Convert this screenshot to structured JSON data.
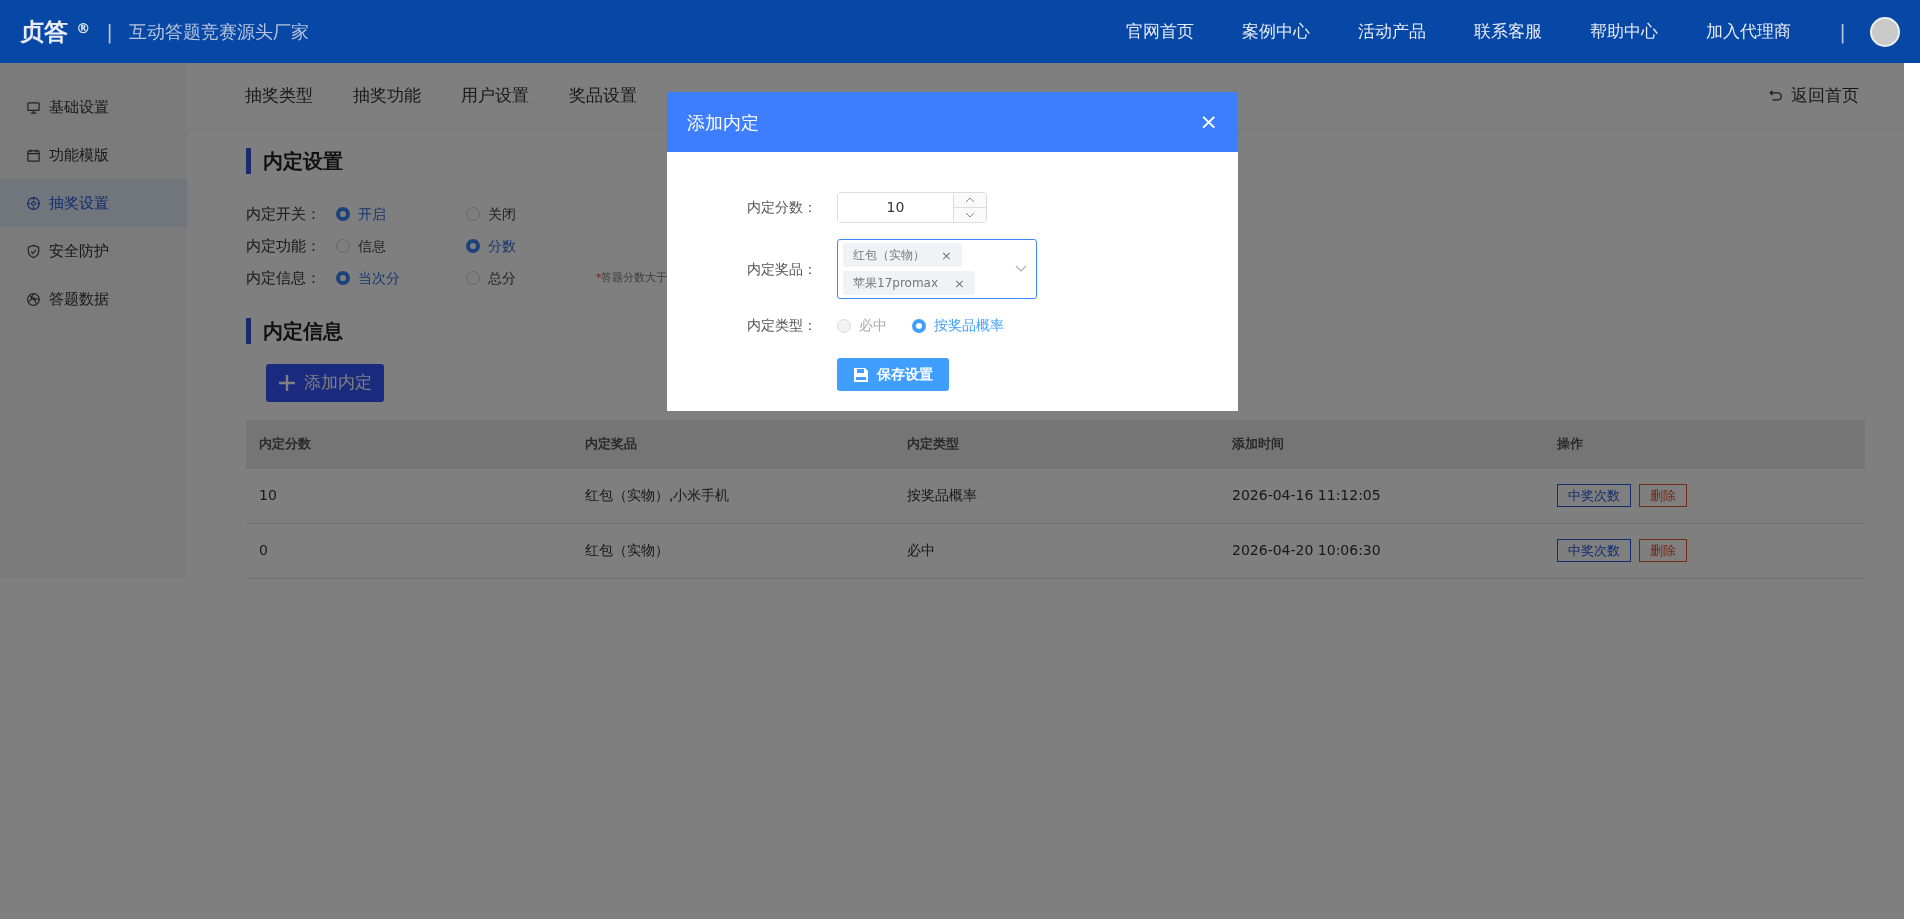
{
  "header": {
    "logo": "贞答",
    "logo_mark": "®",
    "slogan": "互动答题竞赛源头厂家",
    "nav": [
      "官网首页",
      "案例中心",
      "活动产品",
      "联系客服",
      "帮助中心",
      "加入代理商"
    ],
    "divider": "|"
  },
  "sidebar": {
    "items": [
      {
        "label": "基础设置",
        "selected": false
      },
      {
        "label": "功能模版",
        "selected": false
      },
      {
        "label": "抽奖设置",
        "selected": true
      },
      {
        "label": "安全防护",
        "selected": false
      },
      {
        "label": "答题数据",
        "selected": false
      }
    ]
  },
  "tabs": [
    {
      "label": "抽奖类型",
      "selected": false
    },
    {
      "label": "抽奖功能",
      "selected": false
    },
    {
      "label": "用户设置",
      "selected": false
    },
    {
      "label": "奖品设置",
      "selected": false
    }
  ],
  "back_link": "返回首页",
  "settings": {
    "title": "内定设置",
    "rows": [
      {
        "label": "内定开关：",
        "options": [
          {
            "label": "开启",
            "selected": true
          },
          {
            "label": "关闭",
            "selected": false
          }
        ]
      },
      {
        "label": "内定功能：",
        "options": [
          {
            "label": "信息",
            "selected": false
          },
          {
            "label": "分数",
            "selected": true
          }
        ]
      },
      {
        "label": "内定信息：",
        "options": [
          {
            "label": "当次分",
            "selected": true
          },
          {
            "label": "总分",
            "selected": false
          }
        ],
        "note": {
          "mark": "*",
          "text": "答题分数大于"
        }
      }
    ]
  },
  "info": {
    "title": "内定信息",
    "add_button": "添加内定"
  },
  "table": {
    "columns": [
      "内定分数",
      "内定奖品",
      "内定类型",
      "添加时间",
      "操作"
    ],
    "rows": [
      {
        "cells": [
          "10",
          "红包（实物）,小米手机",
          "按奖品概率",
          "2026-04-16 11:12:05"
        ],
        "actions": [
          {
            "label": "中奖次数",
            "kind": "primary"
          },
          {
            "label": "删除",
            "kind": "danger"
          }
        ]
      },
      {
        "cells": [
          "0",
          "红包（实物）",
          "必中",
          "2026-04-20 10:06:30"
        ],
        "actions": [
          {
            "label": "中奖次数",
            "kind": "primary"
          },
          {
            "label": "删除",
            "kind": "danger"
          }
        ]
      }
    ]
  },
  "modal": {
    "title": "添加内定",
    "close": "×",
    "score": {
      "label": "内定分数：",
      "value": "10"
    },
    "prizes": {
      "label": "内定奖品：",
      "tags": [
        "红包（实物）",
        "苹果17promax"
      ]
    },
    "type": {
      "label": "内定类型：",
      "options": [
        {
          "label": "必中",
          "selected": false,
          "disabled": true
        },
        {
          "label": "按奖品概率",
          "selected": true,
          "disabled": false
        }
      ]
    },
    "save_button": "保存设置"
  }
}
